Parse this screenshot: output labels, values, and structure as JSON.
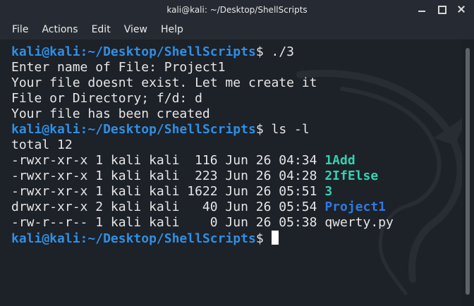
{
  "window": {
    "title": "kali@kali: ~/Desktop/ShellScripts"
  },
  "menu": [
    "File",
    "Actions",
    "Edit",
    "View",
    "Help"
  ],
  "terminal": {
    "prompt": {
      "user": "kali@kali",
      "path": "~/Desktop/ShellScripts",
      "symbol": "$"
    },
    "lines": [
      {
        "type": "prompt",
        "command": " ./3"
      },
      {
        "type": "text",
        "text": "Enter name of File: Project1"
      },
      {
        "type": "text",
        "text": "Your file doesnt exist. Let me create it"
      },
      {
        "type": "text",
        "text": "File or Directory; f/d: d"
      },
      {
        "type": "text",
        "text": "Your file has been created"
      },
      {
        "type": "prompt",
        "command": " ls -l"
      },
      {
        "type": "text",
        "text": "total 12"
      },
      {
        "type": "ls",
        "meta": "-rwxr-xr-x 1 kali kali  116 Jun 26 04:34 ",
        "name": "1Add",
        "kind": "exec"
      },
      {
        "type": "ls",
        "meta": "-rwxr-xr-x 1 kali kali  223 Jun 26 04:28 ",
        "name": "2IfElse",
        "kind": "exec"
      },
      {
        "type": "ls",
        "meta": "-rwxr-xr-x 1 kali kali 1622 Jun 26 05:51 ",
        "name": "3",
        "kind": "exec"
      },
      {
        "type": "ls",
        "meta": "drwxr-xr-x 2 kali kali   40 Jun 26 05:54 ",
        "name": "Project1",
        "kind": "dir"
      },
      {
        "type": "ls",
        "meta": "-rw-r--r-- 1 kali kali    0 Jun 26 05:38 ",
        "name": "qwerty.py",
        "kind": "file"
      },
      {
        "type": "prompt",
        "command": " ",
        "cursor": true
      }
    ]
  },
  "colors": {
    "prompt": "#2f8fe3",
    "executable": "#34d1b0",
    "directory": "#2f7ae0",
    "text": "#e6e6e6",
    "background": "#1d2128"
  },
  "icons": {
    "minimize": "minimize-icon",
    "maximize": "maximize-icon",
    "close": "close-icon"
  }
}
